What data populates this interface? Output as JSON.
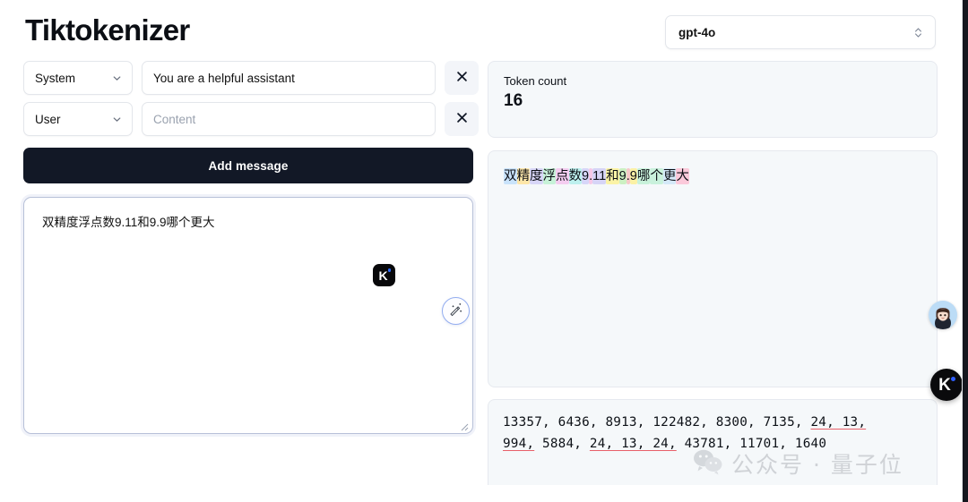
{
  "app": {
    "title": "Tiktokenizer"
  },
  "messages": [
    {
      "role": "System",
      "content": "You are a helpful assistant",
      "placeholder": "Content",
      "remove_label": "×"
    },
    {
      "role": "User",
      "content": "",
      "placeholder": "Content",
      "remove_label": "×"
    }
  ],
  "buttons": {
    "add_message": "Add message"
  },
  "editor": {
    "value": "双精度浮点数9.11和9.9哪个更大",
    "ime_badge_letter": "K",
    "wand_icon": "magic-wand-icon"
  },
  "model": {
    "selected": "gpt-4o",
    "options": [
      "gpt-4o"
    ]
  },
  "token_count": {
    "label": "Token count",
    "value": "16"
  },
  "tokenized": {
    "segments": [
      {
        "text": "双",
        "color": "#c9e3fb"
      },
      {
        "text": "精",
        "color": "#fde6a8"
      },
      {
        "text": "度",
        "color": "#d8d6f7"
      },
      {
        "text": "浮",
        "color": "#c7f2d8"
      },
      {
        "text": "点",
        "color": "#f4cdf0"
      },
      {
        "text": "数",
        "color": "#bdf0ee"
      },
      {
        "text": "9",
        "color": "#d7d6f8"
      },
      {
        "text": ".",
        "color": "#f6c9e8"
      },
      {
        "text": "11",
        "color": "#d6d4f6"
      },
      {
        "text": "和",
        "color": "#fbf3a6"
      },
      {
        "text": "9",
        "color": "#ccf0c2"
      },
      {
        "text": ".",
        "color": "#f6c9c9"
      },
      {
        "text": "9",
        "color": "#fbf1a5"
      },
      {
        "text": "哪",
        "color": "#c8f1da"
      },
      {
        "text": "个",
        "color": "#c9f1dc"
      },
      {
        "text": "更",
        "color": "#d4e9f8"
      },
      {
        "text": "大",
        "color": "#fbc9da"
      }
    ]
  },
  "token_ids": {
    "groups": [
      {
        "text": "13357, 6436, 8913, 122482, 8300, 7135, ",
        "underline": false
      },
      {
        "text": "24, 13,",
        "underline": true
      },
      {
        "text": "\n",
        "underline": false
      },
      {
        "text": "994,",
        "underline": true
      },
      {
        "text": " 5884, ",
        "underline": false
      },
      {
        "text": "24, 13, 24,",
        "underline": true
      },
      {
        "text": " 43781, 11701, 1640",
        "underline": false
      }
    ],
    "underline_color": "#e8606a"
  },
  "overlay": {
    "avatar_name": "user-avatar",
    "k_badge_letter": "K",
    "watermark_text": "公众号 · 量子位"
  }
}
